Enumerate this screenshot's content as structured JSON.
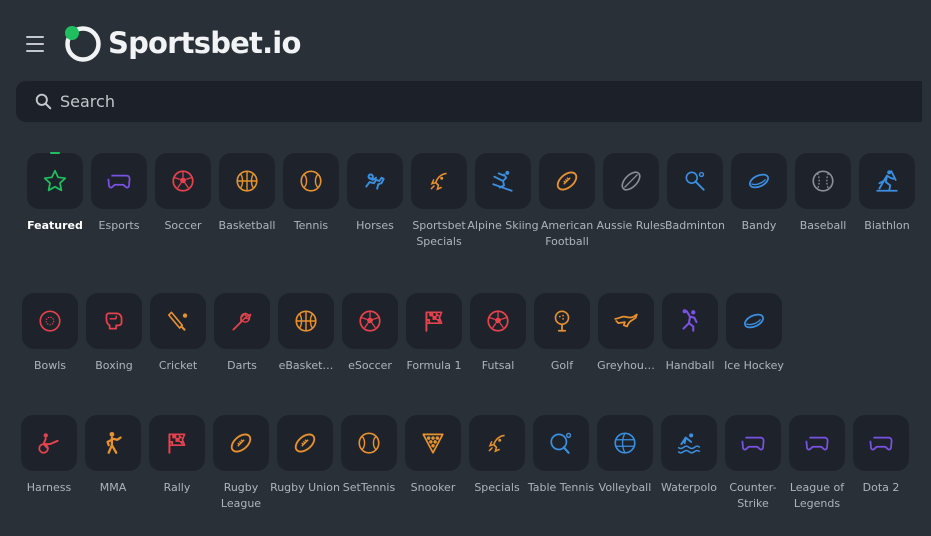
{
  "header": {
    "brand": "Sportsbet.io",
    "menu_icon": "hamburger-menu-icon",
    "logo_accent": "#1fbf5f"
  },
  "search": {
    "placeholder": "Search",
    "value": "",
    "icon": "search-icon"
  },
  "colors": {
    "background": "#2a3038",
    "tile": "#1e232b",
    "active": "#1fbf5f",
    "orange": "#e8912e",
    "red": "#e5424d",
    "blue": "#3b8fe0",
    "purple": "#7a52e6",
    "grey": "#8a9099"
  },
  "sports": [
    {
      "label": "Featured",
      "icon": "star-icon",
      "color": "#1fbf5f",
      "active": true
    },
    {
      "label": "Esports",
      "icon": "gamepad-icon",
      "color": "#7a52e6"
    },
    {
      "label": "Soccer",
      "icon": "soccer-ball-icon",
      "color": "#e5424d"
    },
    {
      "label": "Basketball",
      "icon": "basketball-icon",
      "color": "#e8912e"
    },
    {
      "label": "Tennis",
      "icon": "tennis-ball-icon",
      "color": "#e8912e"
    },
    {
      "label": "Horses",
      "icon": "horse-racing-icon",
      "color": "#3b8fe0"
    },
    {
      "label": "Sportsbet Specials",
      "icon": "rocket-icon",
      "color": "#e8912e"
    },
    {
      "label": "Alpine Skiing",
      "icon": "skier-icon",
      "color": "#3b8fe0"
    },
    {
      "label": "American Football",
      "icon": "american-football-icon",
      "color": "#e8912e"
    },
    {
      "label": "Aussie Rules",
      "icon": "aussie-rules-ball-icon",
      "color": "#8a9099"
    },
    {
      "label": "Badminton",
      "icon": "badminton-icon",
      "color": "#3b8fe0"
    },
    {
      "label": "Bandy",
      "icon": "puck-icon",
      "color": "#3b8fe0"
    },
    {
      "label": "Baseball",
      "icon": "baseball-icon",
      "color": "#8a9099"
    },
    {
      "label": "Biathlon",
      "icon": "biathlon-icon",
      "color": "#3b8fe0"
    },
    {
      "label": "Bowls",
      "icon": "bowls-ball-icon",
      "color": "#e5424d"
    },
    {
      "label": "Boxing",
      "icon": "boxing-glove-icon",
      "color": "#e5424d"
    },
    {
      "label": "Cricket",
      "icon": "cricket-bat-icon",
      "color": "#e8912e"
    },
    {
      "label": "Darts",
      "icon": "dart-icon",
      "color": "#e5424d"
    },
    {
      "label": "eBasket…",
      "icon": "basketball-icon",
      "color": "#e8912e"
    },
    {
      "label": "eSoccer",
      "icon": "soccer-ball-icon",
      "color": "#e5424d"
    },
    {
      "label": "Formula 1",
      "icon": "checkered-flag-icon",
      "color": "#e5424d"
    },
    {
      "label": "Futsal",
      "icon": "soccer-ball-icon",
      "color": "#e5424d"
    },
    {
      "label": "Golf",
      "icon": "golf-ball-icon",
      "color": "#e8912e"
    },
    {
      "label": "Greyhou…",
      "icon": "greyhound-icon",
      "color": "#e8912e"
    },
    {
      "label": "Handball",
      "icon": "handball-player-icon",
      "color": "#7a52e6"
    },
    {
      "label": "Ice Hockey",
      "icon": "puck-icon",
      "color": "#3b8fe0"
    },
    {
      "label": "Harness",
      "icon": "harness-racing-icon",
      "color": "#e5424d"
    },
    {
      "label": "MMA",
      "icon": "fighter-icon",
      "color": "#e8912e"
    },
    {
      "label": "Rally",
      "icon": "checkered-flag-icon",
      "color": "#e5424d"
    },
    {
      "label": "Rugby League",
      "icon": "rugby-ball-icon",
      "color": "#e8912e"
    },
    {
      "label": "Rugby Union",
      "icon": "rugby-ball-icon",
      "color": "#e8912e"
    },
    {
      "label": "SetTennis",
      "icon": "tennis-ball-icon",
      "color": "#e8912e"
    },
    {
      "label": "Snooker",
      "icon": "snooker-rack-icon",
      "color": "#e8912e"
    },
    {
      "label": "Specials",
      "icon": "rocket-icon",
      "color": "#e8912e"
    },
    {
      "label": "Table Tennis",
      "icon": "table-tennis-icon",
      "color": "#3b8fe0"
    },
    {
      "label": "Volleyball",
      "icon": "volleyball-icon",
      "color": "#3b8fe0"
    },
    {
      "label": "Waterpolo",
      "icon": "swimmer-icon",
      "color": "#3b8fe0"
    },
    {
      "label": "Counter-Strike",
      "icon": "gamepad-icon",
      "color": "#7a52e6"
    },
    {
      "label": "League of Legends",
      "icon": "gamepad-icon",
      "color": "#7a52e6"
    },
    {
      "label": "Dota 2",
      "icon": "gamepad-icon",
      "color": "#7a52e6"
    }
  ]
}
